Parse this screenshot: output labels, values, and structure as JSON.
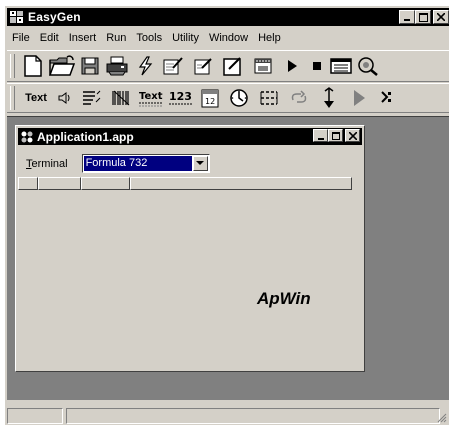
{
  "app": {
    "title": "EasyGen",
    "icon": "app-grid-icon",
    "controls": [
      "minimize-icon",
      "maximize-icon",
      "close-icon"
    ]
  },
  "menu": [
    "File",
    "Edit",
    "Insert",
    "Run",
    "Tools",
    "Utility",
    "Window",
    "Help"
  ],
  "toolbar1": [
    {
      "name": "new-file-icon"
    },
    {
      "name": "open-folder-icon"
    },
    {
      "name": "save-icon"
    },
    {
      "name": "print-icon"
    },
    {
      "name": "lightning-icon"
    },
    {
      "name": "design-check-icon"
    },
    {
      "name": "edit-check-icon"
    },
    {
      "name": "edit-form-icon"
    },
    {
      "name": "film-icon"
    },
    {
      "name": "play-icon"
    },
    {
      "name": "stop-icon"
    },
    {
      "name": "window-list-icon"
    },
    {
      "name": "debug-icon"
    }
  ],
  "toolbar2": {
    "text_label": "Text",
    "text_label2": "Text",
    "number_label": "123",
    "items": [
      "text-tool",
      "speaker-icon",
      "list-icon",
      "barcode-icon",
      "text-field-icon",
      "number-field-icon",
      "calendar-icon",
      "clock-icon",
      "grid-icon",
      "loop-icon",
      "step-icon",
      "run-icon",
      "breakpoint-icon"
    ]
  },
  "child_window": {
    "title": "Application1.app",
    "icon": "app-icon",
    "terminal_label_prefix": "T",
    "terminal_label_rest": "erminal",
    "terminal_value": "Formula 732"
  },
  "brand_text": "ApWin",
  "colors": {
    "face": "#d4d0c8",
    "titlebar": "#000000",
    "mdi": "#808080",
    "selection": "#000080"
  }
}
